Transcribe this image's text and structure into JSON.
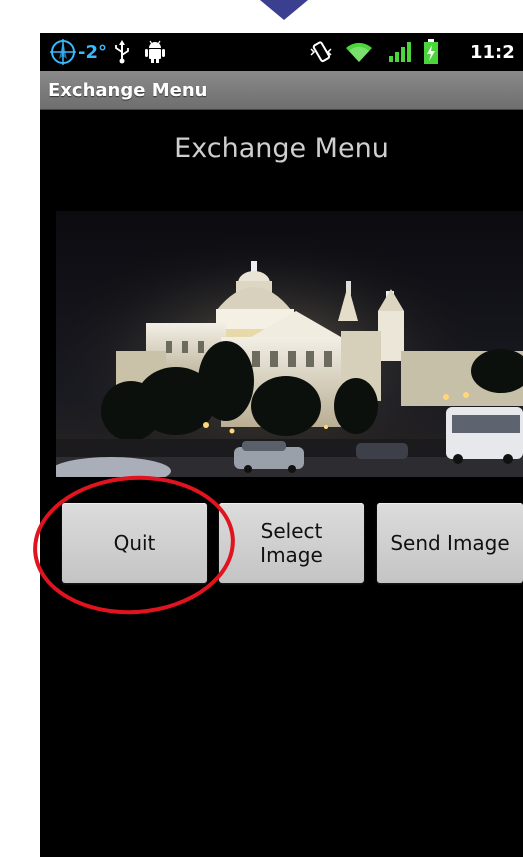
{
  "status_bar": {
    "temperature": "-2°",
    "time": "11:2",
    "icons": [
      "compass-icon",
      "usb-icon",
      "android-debug-icon",
      "vibrate-icon",
      "wifi-icon",
      "signal-icon",
      "battery-charging-icon"
    ],
    "accent_color": "#38b8ff"
  },
  "title_bar": {
    "title": "Exchange Menu"
  },
  "main": {
    "heading": "Exchange Menu",
    "image_alt": "night-photo-cathedral",
    "buttons": {
      "quit": "Quit",
      "select_image": "Select\nImage",
      "send_image": "Send Image"
    }
  },
  "annotation": {
    "type": "red-ellipse",
    "color": "#e0141e",
    "target": "quit-button"
  }
}
